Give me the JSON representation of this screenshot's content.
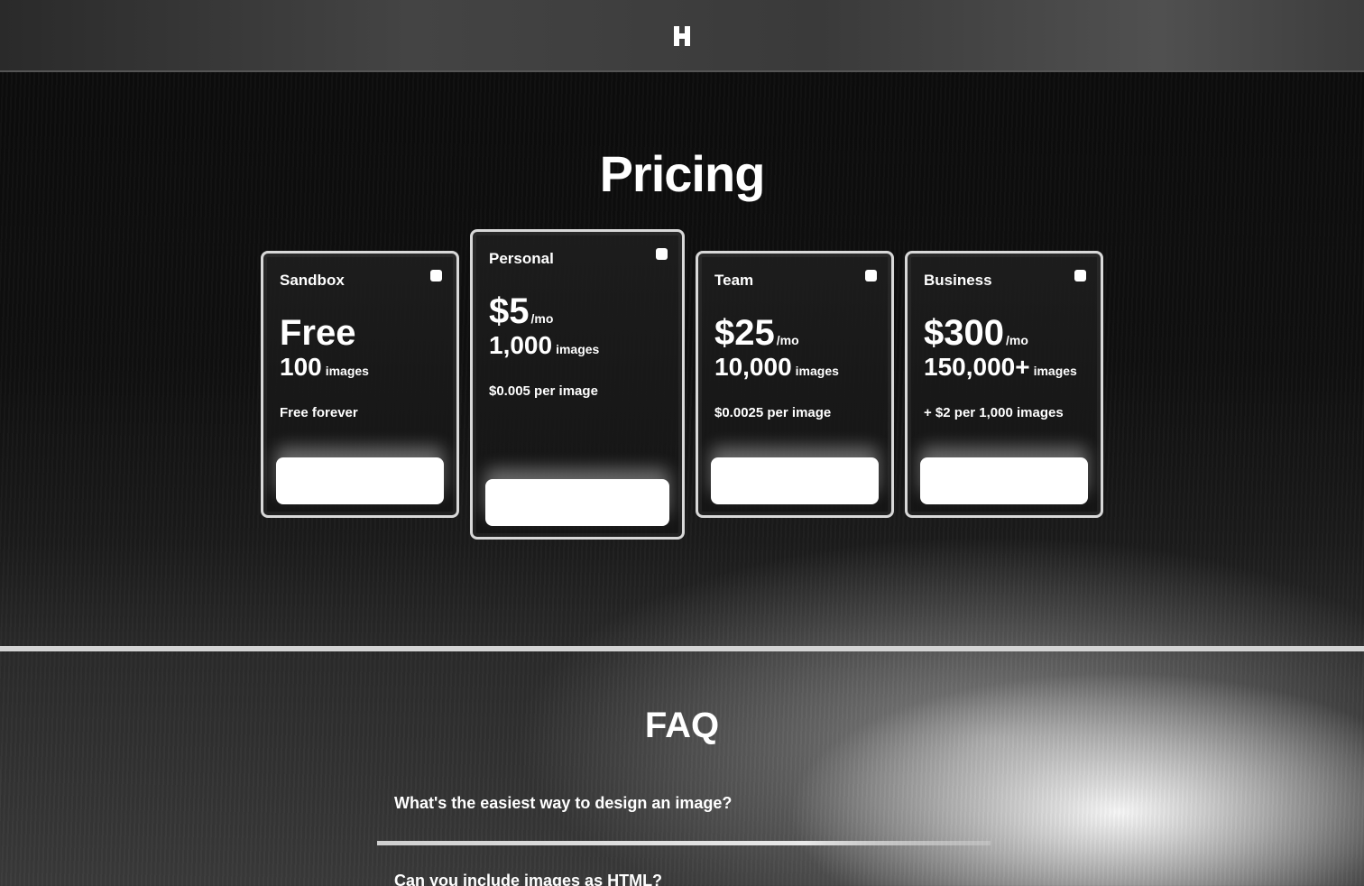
{
  "nav": {
    "logo_icon": "h-logo-icon"
  },
  "pricing": {
    "title": "Pricing",
    "plans": [
      {
        "name": "Sandbox",
        "price": "Free",
        "per": "",
        "quota": "100",
        "unit": "images",
        "note": "Free forever",
        "check_icon": "check-icon"
      },
      {
        "name": "Personal",
        "price": "$5",
        "per": "/mo",
        "quota": "1,000",
        "unit": "images",
        "note": "$0.005 per image",
        "check_icon": "check-icon"
      },
      {
        "name": "Team",
        "price": "$25",
        "per": "/mo",
        "quota": "10,000",
        "unit": "images",
        "note": "$0.0025 per image",
        "check_icon": "check-icon"
      },
      {
        "name": "Business",
        "price": "$300",
        "per": "/mo",
        "quota": "150,000+",
        "unit": "images",
        "note": "+ $2 per 1,000 images",
        "check_icon": "check-icon"
      }
    ]
  },
  "faq": {
    "title": "FAQ",
    "questions": [
      "What's the easiest way to design an image?",
      "Can you include images as HTML?"
    ]
  }
}
